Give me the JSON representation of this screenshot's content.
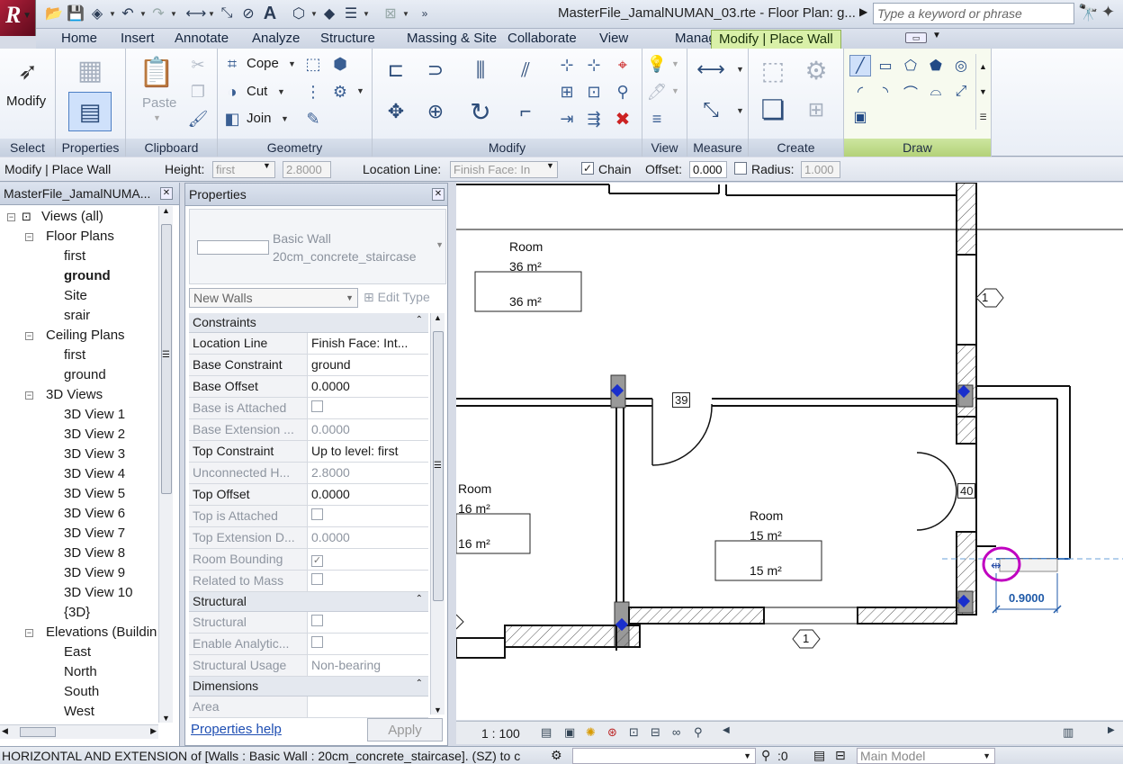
{
  "titlebar": {
    "document_title": "MasterFile_JamalNUMAN_03.rte - Floor Plan: g...",
    "search_placeholder": "Type a keyword or phrase"
  },
  "tabs": [
    {
      "label": "Home"
    },
    {
      "label": "Insert"
    },
    {
      "label": "Annotate"
    },
    {
      "label": "Analyze"
    },
    {
      "label": "Structure"
    },
    {
      "label": "Massing & Site"
    },
    {
      "label": "Collaborate"
    },
    {
      "label": "View"
    },
    {
      "label": "Manage"
    },
    {
      "label": "Modify | Place Wall"
    }
  ],
  "ribbon": {
    "select": {
      "title": "Select",
      "modify_label": "Modify"
    },
    "properties": {
      "title": "Properties"
    },
    "clipboard": {
      "title": "Clipboard",
      "paste_label": "Paste"
    },
    "geometry": {
      "title": "Geometry",
      "cope_label": "Cope",
      "cut_label": "Cut",
      "join_label": "Join"
    },
    "modify": {
      "title": "Modify"
    },
    "view": {
      "title": "View"
    },
    "measure": {
      "title": "Measure"
    },
    "create": {
      "title": "Create"
    },
    "draw": {
      "title": "Draw"
    }
  },
  "optionsbar": {
    "context": "Modify | Place Wall",
    "height_label": "Height:",
    "height_value": "first",
    "height_number": "2.8000",
    "location_label": "Location Line:",
    "location_value": "Finish Face: In",
    "chain_label": "Chain",
    "offset_label": "Offset:",
    "offset_value": "0.000",
    "radius_label": "Radius:",
    "radius_value": "1.000"
  },
  "browser": {
    "title": "MasterFile_JamalNUMA...",
    "items": [
      {
        "label": "Views (all)",
        "level": 0
      },
      {
        "label": "Floor Plans",
        "level": 1
      },
      {
        "label": "first",
        "level": 2
      },
      {
        "label": "ground",
        "level": 2,
        "bold": true
      },
      {
        "label": "Site",
        "level": 2
      },
      {
        "label": "srair",
        "level": 2
      },
      {
        "label": "Ceiling Plans",
        "level": 1
      },
      {
        "label": "first",
        "level": 2
      },
      {
        "label": "ground",
        "level": 2
      },
      {
        "label": "3D Views",
        "level": 1
      },
      {
        "label": "3D View 1",
        "level": 2
      },
      {
        "label": "3D View 2",
        "level": 2
      },
      {
        "label": "3D View 3",
        "level": 2
      },
      {
        "label": "3D View 4",
        "level": 2
      },
      {
        "label": "3D View 5",
        "level": 2
      },
      {
        "label": "3D View 6",
        "level": 2
      },
      {
        "label": "3D View 7",
        "level": 2
      },
      {
        "label": "3D View 8",
        "level": 2
      },
      {
        "label": "3D View 9",
        "level": 2
      },
      {
        "label": "3D View 10",
        "level": 2
      },
      {
        "label": "{3D}",
        "level": 2
      },
      {
        "label": "Elevations (Buildin",
        "level": 1
      },
      {
        "label": "East",
        "level": 2
      },
      {
        "label": "North",
        "level": 2
      },
      {
        "label": "South",
        "level": 2
      },
      {
        "label": "West",
        "level": 2
      }
    ]
  },
  "properties": {
    "title": "Properties",
    "family": "Basic Wall",
    "type": "20cm_concrete_staircase",
    "instance_filter": "New Walls",
    "edit_type_label": "Edit Type",
    "sections": [
      {
        "title": "Constraints",
        "rows": [
          {
            "k": "Location Line",
            "v": "Finish Face: Int..."
          },
          {
            "k": "Base Constraint",
            "v": "ground"
          },
          {
            "k": "Base Offset",
            "v": "0.0000"
          },
          {
            "k": "Base is Attached",
            "v": "",
            "check": true,
            "dim": true
          },
          {
            "k": "Base Extension ...",
            "v": "0.0000",
            "dim": true
          },
          {
            "k": "Top Constraint",
            "v": "Up to level: first"
          },
          {
            "k": "Unconnected H...",
            "v": "2.8000",
            "dim": true
          },
          {
            "k": "Top Offset",
            "v": "0.0000"
          },
          {
            "k": "Top is Attached",
            "v": "",
            "check": true,
            "dim": true
          },
          {
            "k": "Top Extension D...",
            "v": "0.0000",
            "dim": true
          },
          {
            "k": "Room Bounding",
            "v": "",
            "check": true,
            "checked": true,
            "dim": true
          },
          {
            "k": "Related to Mass",
            "v": "",
            "check": true,
            "dim": true
          }
        ]
      },
      {
        "title": "Structural",
        "rows": [
          {
            "k": "Structural",
            "v": "",
            "check": true,
            "dim": true
          },
          {
            "k": "Enable Analytic...",
            "v": "",
            "check": true,
            "dim": true
          },
          {
            "k": "Structural Usage",
            "v": "Non-bearing",
            "dim": true
          }
        ]
      },
      {
        "title": "Dimensions",
        "rows": [
          {
            "k": "Area",
            "v": "",
            "dim": true
          }
        ]
      }
    ],
    "help_label": "Properties help",
    "apply_label": "Apply"
  },
  "canvas": {
    "rooms": [
      {
        "name": "Room",
        "area": "36 m²",
        "tag": "36 m²"
      },
      {
        "name": "Room",
        "area": "16 m²",
        "tag": "16 m²"
      },
      {
        "name": "Room",
        "area": "15 m²",
        "tag": "15 m²"
      }
    ],
    "door_tags": [
      "39",
      "40"
    ],
    "section_tags": [
      "1",
      "1"
    ],
    "temp_dimension": "0.9000"
  },
  "viewbar": {
    "scale": "1 : 100"
  },
  "statusbar": {
    "text": "HORIZONTAL AND EXTENSION  of [Walls : Basic Wall : 20cm_concrete_staircase].  (SZ) to c",
    "selection_count": ":0",
    "model": "Main Model"
  },
  "colors": {
    "active_tab": "#d9f0a8",
    "draw_panel": "#b3d278",
    "highlight": "#c000c0",
    "dimension": "#1f5aa8"
  }
}
